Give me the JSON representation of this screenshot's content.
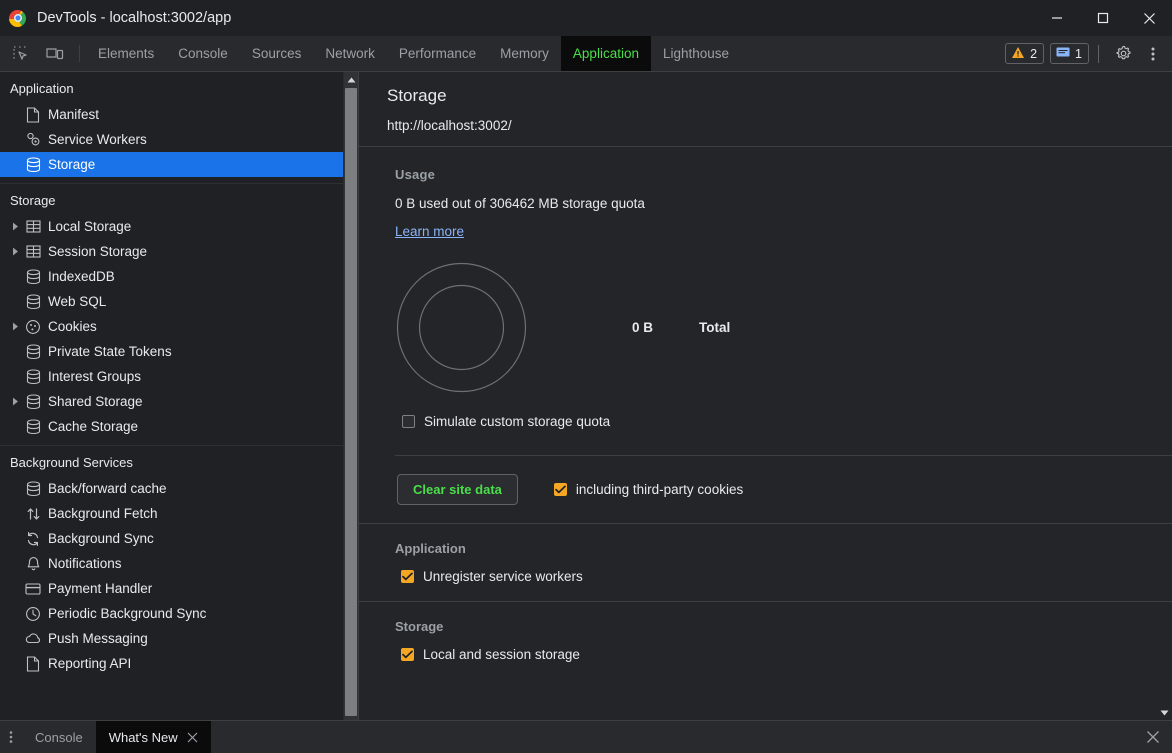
{
  "window": {
    "title": "DevTools - localhost:3002/app",
    "logo_icon": "chrome-logo",
    "minimize_icon": "minimize-icon",
    "maximize_icon": "maximize-icon",
    "close_icon": "close-icon"
  },
  "toolbar": {
    "inspect_icon": "inspect-element-icon",
    "device_icon": "device-toolbar-icon",
    "tabs": [
      {
        "label": "Elements",
        "active": false
      },
      {
        "label": "Console",
        "active": false
      },
      {
        "label": "Sources",
        "active": false
      },
      {
        "label": "Network",
        "active": false
      },
      {
        "label": "Performance",
        "active": false
      },
      {
        "label": "Memory",
        "active": false
      },
      {
        "label": "Application",
        "active": true
      },
      {
        "label": "Lighthouse",
        "active": false
      }
    ],
    "warnings": {
      "icon": "warning-triangle-icon",
      "count": "2",
      "color": "#f5a623"
    },
    "messages": {
      "icon": "message-icon",
      "count": "1",
      "color": "#8ab4f8"
    },
    "settings_icon": "gear-icon",
    "more_icon": "kebab-menu-icon"
  },
  "sidebar": {
    "groups": [
      {
        "title": "Application",
        "items": [
          {
            "label": "Manifest",
            "icon": "document-icon",
            "arrow": false,
            "selected": false
          },
          {
            "label": "Service Workers",
            "icon": "gears-icon",
            "arrow": false,
            "selected": false
          },
          {
            "label": "Storage",
            "icon": "database-icon",
            "arrow": false,
            "selected": true
          }
        ]
      },
      {
        "title": "Storage",
        "items": [
          {
            "label": "Local Storage",
            "icon": "table-icon",
            "arrow": true,
            "selected": false
          },
          {
            "label": "Session Storage",
            "icon": "table-icon",
            "arrow": true,
            "selected": false
          },
          {
            "label": "IndexedDB",
            "icon": "database-icon",
            "arrow": false,
            "selected": false
          },
          {
            "label": "Web SQL",
            "icon": "database-icon",
            "arrow": false,
            "selected": false
          },
          {
            "label": "Cookies",
            "icon": "cookie-icon",
            "arrow": true,
            "selected": false
          },
          {
            "label": "Private State Tokens",
            "icon": "database-icon",
            "arrow": false,
            "selected": false
          },
          {
            "label": "Interest Groups",
            "icon": "database-icon",
            "arrow": false,
            "selected": false
          },
          {
            "label": "Shared Storage",
            "icon": "database-icon",
            "arrow": true,
            "selected": false
          },
          {
            "label": "Cache Storage",
            "icon": "database-icon",
            "arrow": false,
            "selected": false
          }
        ]
      },
      {
        "title": "Background Services",
        "items": [
          {
            "label": "Back/forward cache",
            "icon": "database-icon",
            "arrow": false,
            "selected": false
          },
          {
            "label": "Background Fetch",
            "icon": "arrows-updown-icon",
            "arrow": false,
            "selected": false
          },
          {
            "label": "Background Sync",
            "icon": "sync-icon",
            "arrow": false,
            "selected": false
          },
          {
            "label": "Notifications",
            "icon": "bell-icon",
            "arrow": false,
            "selected": false
          },
          {
            "label": "Payment Handler",
            "icon": "credit-card-icon",
            "arrow": false,
            "selected": false
          },
          {
            "label": "Periodic Background Sync",
            "icon": "clock-icon",
            "arrow": false,
            "selected": false
          },
          {
            "label": "Push Messaging",
            "icon": "cloud-icon",
            "arrow": false,
            "selected": false
          },
          {
            "label": "Reporting API",
            "icon": "document-icon",
            "arrow": false,
            "selected": false
          }
        ]
      }
    ],
    "scroll_up_icon": "scroll-up-arrow-icon",
    "scroll_down_icon": "scroll-down-arrow-icon"
  },
  "panel": {
    "title": "Storage",
    "url": "http://localhost:3002/",
    "usage": {
      "heading": "Usage",
      "text": "0 B used out of 306462 MB storage quota",
      "learn_more": "Learn more",
      "legend_value": "0 B",
      "legend_label": "Total",
      "simulate_quota_label": "Simulate custom storage quota",
      "simulate_quota_checked": false
    },
    "clear": {
      "button_label": "Clear site data",
      "button_color": "#4ade4a",
      "third_party_label": "including third-party cookies",
      "third_party_checked": true
    },
    "application": {
      "heading": "Application",
      "items": [
        {
          "label": "Unregister service workers",
          "checked": true
        }
      ]
    },
    "storage": {
      "heading": "Storage",
      "items": [
        {
          "label": "Local and session storage",
          "checked": true
        }
      ]
    },
    "scroll_down_icon": "scroll-down-arrow-icon"
  },
  "drawer": {
    "kebab_icon": "kebab-menu-icon",
    "tabs": [
      {
        "label": "Console",
        "active": false,
        "closable": false
      },
      {
        "label": "What's New",
        "active": true,
        "closable": true
      }
    ],
    "close_tab_icon": "close-icon",
    "close_drawer_icon": "close-icon"
  },
  "chart_data": {
    "type": "pie",
    "title": "Storage usage",
    "categories": [
      "Total"
    ],
    "values": [
      0
    ],
    "unit": "B",
    "total_label": "0 B",
    "quota_mb": 306462,
    "used_bytes": 0,
    "legend": [
      "Total"
    ],
    "legend_position": "right",
    "empty": true
  },
  "colors": {
    "accent_selected": "#1a73e8",
    "tab_active_text": "#4ade4a",
    "checkbox_on": "#f5a623",
    "link": "#8ab4f8",
    "bg_sidebar": "#202124",
    "bg_panel": "#242528"
  }
}
